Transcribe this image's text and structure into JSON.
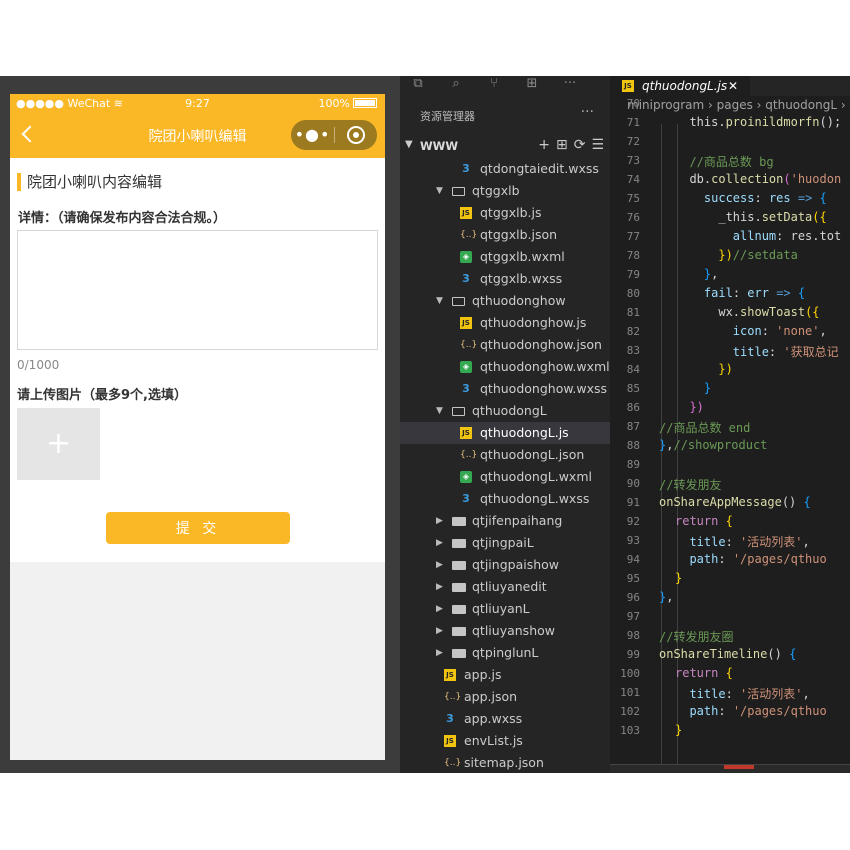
{
  "phone": {
    "status": {
      "carrier": "●●●●● WeChat",
      "wifi_icon": "wifi-icon",
      "time": "9:27",
      "battery": "100%"
    },
    "nav": {
      "title": "院团小喇叭编辑",
      "more": "•●•"
    },
    "form": {
      "section_title": "院团小喇叭内容编辑",
      "detail_label": "详情：（请确保发布内容合法合规。）",
      "detail_value": "",
      "counter": "0/1000",
      "upload_label": "请上传图片（最多9个,选填）",
      "upload_plus": "+",
      "submit": "提 交"
    },
    "colors": {
      "accent": "#fbb826"
    }
  },
  "ide": {
    "activity": {
      "more": "···"
    },
    "explorer": {
      "header": "资源管理器",
      "more": "···",
      "root": "WWW",
      "tools": [
        "+",
        "⊞",
        "⟳",
        "☰"
      ],
      "rows": [
        {
          "label": "qtdongtaiedit.wxss",
          "type": "wxss",
          "depth": 2
        },
        {
          "label": "qtggxlb",
          "type": "folder-open",
          "depth": 1
        },
        {
          "label": "qtggxlb.js",
          "type": "js",
          "depth": 2
        },
        {
          "label": "qtggxlb.json",
          "type": "json",
          "depth": 2
        },
        {
          "label": "qtggxlb.wxml",
          "type": "wxml",
          "depth": 2
        },
        {
          "label": "qtggxlb.wxss",
          "type": "wxss",
          "depth": 2
        },
        {
          "label": "qthuodonghow",
          "type": "folder-open",
          "depth": 1
        },
        {
          "label": "qthuodonghow.js",
          "type": "js",
          "depth": 2
        },
        {
          "label": "qthuodonghow.json",
          "type": "json",
          "depth": 2
        },
        {
          "label": "qthuodonghow.wxml",
          "type": "wxml",
          "depth": 2
        },
        {
          "label": "qthuodonghow.wxss",
          "type": "wxss",
          "depth": 2
        },
        {
          "label": "qthuodongL",
          "type": "folder-open",
          "depth": 1
        },
        {
          "label": "qthuodongL.js",
          "type": "js",
          "depth": 2,
          "selected": true
        },
        {
          "label": "qthuodongL.json",
          "type": "json",
          "depth": 2
        },
        {
          "label": "qthuodongL.wxml",
          "type": "wxml",
          "depth": 2
        },
        {
          "label": "qthuodongL.wxss",
          "type": "wxss",
          "depth": 2
        },
        {
          "label": "qtjifenpaihang",
          "type": "folder",
          "depth": 1
        },
        {
          "label": "qtjingpaiL",
          "type": "folder",
          "depth": 1
        },
        {
          "label": "qtjingpaishow",
          "type": "folder",
          "depth": 1
        },
        {
          "label": "qtliuyanedit",
          "type": "folder",
          "depth": 1
        },
        {
          "label": "qtliuyanL",
          "type": "folder",
          "depth": 1
        },
        {
          "label": "qtliuyanshow",
          "type": "folder",
          "depth": 1
        },
        {
          "label": "qtpinglunL",
          "type": "folder",
          "depth": 1
        },
        {
          "label": "app.js",
          "type": "js",
          "depth": 0
        },
        {
          "label": "app.json",
          "type": "json",
          "depth": 0
        },
        {
          "label": "app.wxss",
          "type": "wxss",
          "depth": 0
        },
        {
          "label": "envList.js",
          "type": "js",
          "depth": 0
        },
        {
          "label": "sitemap.json",
          "type": "json",
          "depth": 0
        }
      ]
    },
    "editor": {
      "tab": {
        "label": "qthuodongL.js",
        "close": "✕",
        "badge": "JS"
      },
      "breadcrumb": "miniprogram › pages › qthuodongL ›",
      "line_numbers": [
        "70",
        "71",
        "72",
        "73",
        "74",
        "75",
        "76",
        "77",
        "78",
        "79",
        "80",
        "81",
        "82",
        "83",
        "84",
        "85",
        "86",
        "87",
        "88",
        "89",
        "90",
        "91",
        "92",
        "93",
        "94",
        "95",
        "96",
        "97",
        "98",
        "99",
        "100",
        "101",
        "102",
        "103"
      ]
    }
  }
}
